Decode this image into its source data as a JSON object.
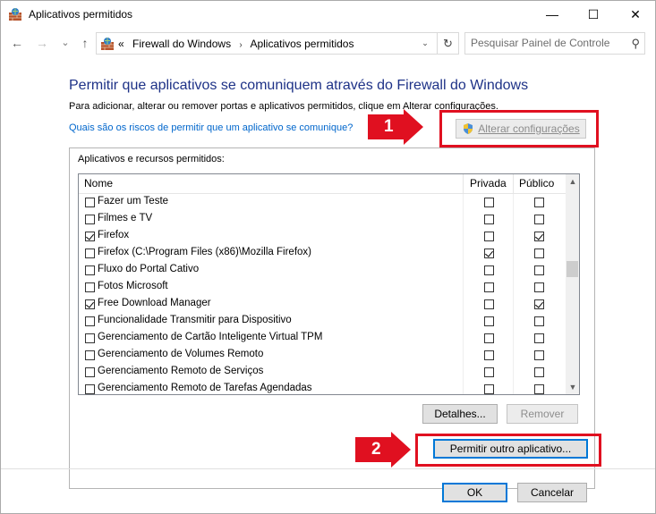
{
  "window": {
    "title": "Aplicativos permitidos",
    "minimize": "—",
    "maximize": "☐",
    "close": "✕"
  },
  "nav": {
    "back": "←",
    "forward": "→",
    "recent": "⌄",
    "up": "↑",
    "crumb_overflow": "«",
    "crumbs": [
      "Firewall do Windows",
      "Aplicativos permitidos"
    ],
    "crumb_sep": "›",
    "dropdown": "⌄",
    "refresh": "↻",
    "search_placeholder": "Pesquisar Painel de Controle",
    "search_icon": "⚲"
  },
  "main": {
    "heading": "Permitir que aplicativos se comuniquem através do Firewall do Windows",
    "description": "Para adicionar, alterar ou remover portas e aplicativos permitidos, clique em Alterar configurações.",
    "risk_link": "Quais são os riscos de permitir que um aplicativo se comunique?",
    "change_settings": "Alterar configurações",
    "group_title": "Aplicativos e recursos permitidos:",
    "columns": {
      "name": "Nome",
      "private": "Privada",
      "public": "Público"
    },
    "rows": [
      {
        "name": "Fazer um Teste",
        "enabled": false,
        "private": false,
        "public": false
      },
      {
        "name": "Filmes e TV",
        "enabled": false,
        "private": false,
        "public": false
      },
      {
        "name": "Firefox",
        "enabled": true,
        "private": false,
        "public": true
      },
      {
        "name": "Firefox (C:\\Program Files (x86)\\Mozilla Firefox)",
        "enabled": false,
        "private": true,
        "public": false
      },
      {
        "name": "Fluxo do Portal Cativo",
        "enabled": false,
        "private": false,
        "public": false
      },
      {
        "name": "Fotos Microsoft",
        "enabled": false,
        "private": false,
        "public": false
      },
      {
        "name": "Free Download Manager",
        "enabled": true,
        "private": false,
        "public": true
      },
      {
        "name": "Funcionalidade Transmitir para Dispositivo",
        "enabled": false,
        "private": false,
        "public": false
      },
      {
        "name": "Gerenciamento de Cartão Inteligente Virtual TPM",
        "enabled": false,
        "private": false,
        "public": false
      },
      {
        "name": "Gerenciamento de Volumes Remoto",
        "enabled": false,
        "private": false,
        "public": false
      },
      {
        "name": "Gerenciamento Remoto de Serviços",
        "enabled": false,
        "private": false,
        "public": false
      },
      {
        "name": "Gerenciamento Remoto de Tarefas Agendadas",
        "enabled": false,
        "private": false,
        "public": false
      }
    ],
    "scroll_up": "▲",
    "scroll_down": "▼",
    "details": "Detalhes...",
    "remove": "Remover",
    "allow_other": "Permitir outro aplicativo...",
    "ok": "OK",
    "cancel": "Cancelar"
  },
  "annotations": {
    "badge1": "1",
    "badge2": "2",
    "color": "#e01020"
  },
  "colors": {
    "heading": "#1e3287",
    "link": "#0066cc",
    "accent": "#0078d7"
  }
}
